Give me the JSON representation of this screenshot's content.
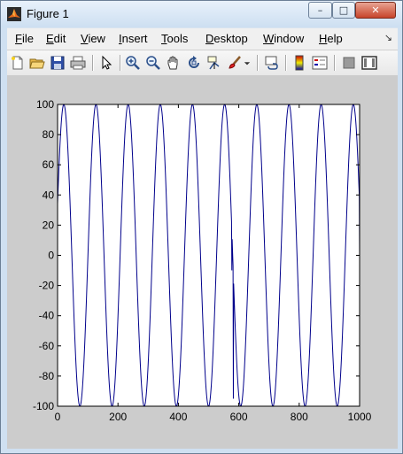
{
  "window": {
    "title": "Figure 1",
    "controls": {
      "minimize": "–",
      "maximize": "□",
      "close": "✕"
    }
  },
  "menu": [
    {
      "label": "File",
      "key": "F",
      "rest": "ile"
    },
    {
      "label": "Edit",
      "key": "E",
      "rest": "dit"
    },
    {
      "label": "View",
      "key": "V",
      "rest": "iew"
    },
    {
      "label": "Insert",
      "key": "I",
      "rest": "nsert"
    },
    {
      "label": "Tools",
      "key": "T",
      "rest": "ools"
    },
    {
      "label": "Desktop",
      "key": "D",
      "rest": "esktop"
    },
    {
      "label": "Window",
      "key": "W",
      "rest": "indow"
    },
    {
      "label": "Help",
      "key": "H",
      "rest": "elp"
    }
  ],
  "toolbar": {
    "icons": [
      "new-figure-icon",
      "open-file-icon",
      "save-icon",
      "print-icon",
      "pointer-icon",
      "zoom-in-icon",
      "zoom-out-icon",
      "pan-icon",
      "rotate-3d-icon",
      "data-cursor-icon",
      "brush-icon",
      "brush-dropdown-icon",
      "link-plot-icon",
      "colorbar-icon",
      "legend-icon",
      "hide-plot-tools-icon",
      "show-plot-tools-icon"
    ]
  },
  "colors": {
    "line": "#00008b",
    "figure_bg": "#cccccc",
    "axes_bg": "#ffffff"
  },
  "chart_data": {
    "type": "line",
    "title": "",
    "xlabel": "",
    "ylabel": "",
    "xlim": [
      0,
      1000
    ],
    "ylim": [
      -100,
      100
    ],
    "xticks": [
      0,
      200,
      400,
      600,
      800,
      1000
    ],
    "yticks": [
      -100,
      -80,
      -60,
      -40,
      -20,
      0,
      20,
      40,
      60,
      80,
      100
    ],
    "grid": false,
    "series": [
      {
        "function": "100*sin(2*pi*x/106.5 + 0.35)",
        "x_range": [
          0,
          1000
        ],
        "samples": 1001,
        "glitches": [
          {
            "x": 577,
            "y": -10
          },
          {
            "x": 582,
            "y": -95
          },
          {
            "x": 1000,
            "y": 0
          }
        ]
      }
    ]
  }
}
